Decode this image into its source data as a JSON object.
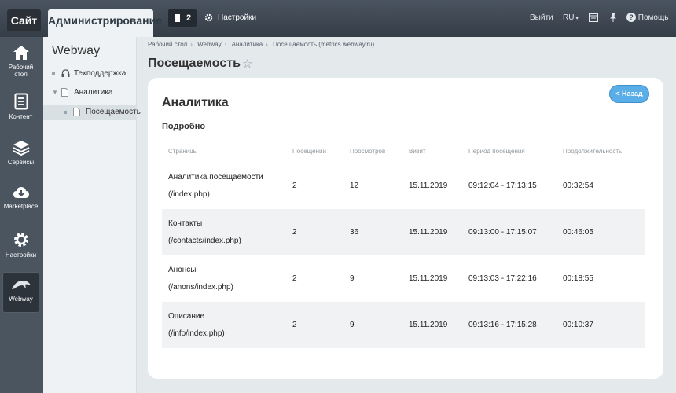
{
  "topbar": {
    "site_tab": "Сайт",
    "admin_tab": "Администрирование",
    "notifications_count": "2",
    "settings_label": "Настройки",
    "logout_label": "Выйти",
    "language": "RU",
    "help_label": "Помощь"
  },
  "rail": {
    "items": [
      {
        "label": "Рабочий стол",
        "icon": "house-icon"
      },
      {
        "label": "Контент",
        "icon": "document-icon"
      },
      {
        "label": "Сервисы",
        "icon": "layers-icon"
      },
      {
        "label": "Marketplace",
        "icon": "cloud-download-icon"
      },
      {
        "label": "Настройки",
        "icon": "gear-icon"
      },
      {
        "label": "Webway",
        "icon": "dolphin-icon"
      }
    ]
  },
  "menu": {
    "title": "Webway",
    "items": [
      {
        "label": "Техподдержка",
        "icon": "headset-icon"
      },
      {
        "label": "Аналитика",
        "icon": "page-icon"
      },
      {
        "label": "Посещаемость",
        "icon": "page-icon"
      }
    ]
  },
  "breadcrumbs": [
    "Рабочий стол",
    "Webway",
    "Аналитика",
    "Посещаемость (metrics.webway.ru)"
  ],
  "page": {
    "title": "Посещаемость",
    "back_label": "< Назад",
    "section_title": "Аналитика",
    "subsection_title": "Подробно"
  },
  "table": {
    "headers": [
      "Страницы",
      "Посещений",
      "Просмотров",
      "Визит",
      "Период посещения",
      "Продолжительность"
    ],
    "rows": [
      {
        "name": "Аналитика посещаемости",
        "path": "(/index.php)",
        "visits": "2",
        "views": "12",
        "date": "15.11.2019",
        "period": "09:12:04 - 17:13:15",
        "duration": "00:32:54"
      },
      {
        "name": "Контакты",
        "path": "(/contacts/index.php)",
        "visits": "2",
        "views": "36",
        "date": "15.11.2019",
        "period": "09:13:00 - 17:15:07",
        "duration": "00:46:05"
      },
      {
        "name": "Анонсы",
        "path": "(/anons/index.php)",
        "visits": "2",
        "views": "9",
        "date": "15.11.2019",
        "period": "09:13:03 - 17:22:16",
        "duration": "00:18:55"
      },
      {
        "name": "Описание",
        "path": "(/info/index.php)",
        "visits": "2",
        "views": "9",
        "date": "15.11.2019",
        "period": "09:13:16 - 17:15:28",
        "duration": "00:10:37"
      }
    ]
  },
  "colors": {
    "topbar": "#3d4651",
    "rail": "#4b5560",
    "accent": "#5aaee8"
  }
}
